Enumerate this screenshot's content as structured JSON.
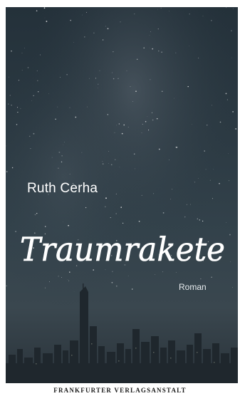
{
  "book": {
    "author": "Ruth Cerha",
    "title": "Traumrakete",
    "genre": "Roman",
    "publisher": "FRANKFURTER VERLAGSANSTALT"
  },
  "colors": {
    "sky_top": "#24313a",
    "sky_bottom": "#3a474f",
    "text": "#ffffff",
    "skyline": "#1f272d"
  }
}
